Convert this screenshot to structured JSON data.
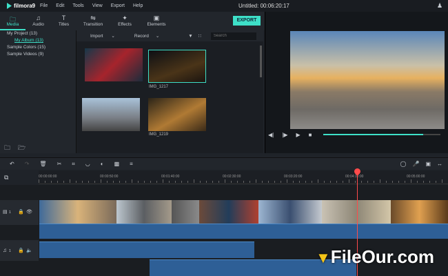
{
  "app": {
    "logo": "filmora9",
    "title": "Untitled:",
    "timecode": "00:06:20:17"
  },
  "menu": [
    "File",
    "Edit",
    "Tools",
    "View",
    "Export",
    "Help"
  ],
  "tabs": [
    {
      "label": "Media",
      "icon": "folder-icon"
    },
    {
      "label": "Audio",
      "icon": "music-icon"
    },
    {
      "label": "Titles",
      "icon": "titles-icon"
    },
    {
      "label": "Transition",
      "icon": "transition-icon"
    },
    {
      "label": "Effects",
      "icon": "effects-icon"
    },
    {
      "label": "Elements",
      "icon": "elements-icon"
    }
  ],
  "export_label": "EXPORT",
  "sidebar": [
    "My Project (13)",
    "My Album (13)",
    "Sample Colors (15)",
    "Sample Videos (9)"
  ],
  "media_toolbar": {
    "import": "Import",
    "record": "Record",
    "search_placeholder": "Search"
  },
  "media_items": [
    "IMG_1217",
    "IMG_1219"
  ],
  "timeline": {
    "timecodes": [
      "00:00:00:00",
      "00:00:50:00",
      "00:01:40:00",
      "00:02:30:00",
      "00:03:20:00",
      "00:04:10:00",
      "00:05:00:00"
    ],
    "video_track": "1",
    "audio_track": "1"
  },
  "playback_progress": 0.85,
  "watermark": "FileOur.com",
  "colors": {
    "accent": "#3ee0c8",
    "playhead": "#ff4b4b",
    "audio": "#2e5f96"
  }
}
